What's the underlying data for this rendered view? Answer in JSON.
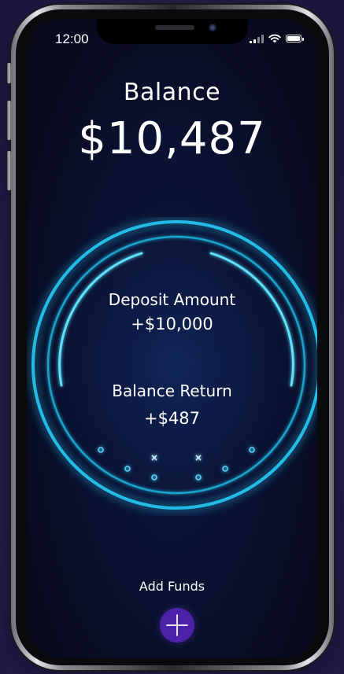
{
  "status_bar": {
    "time": "12:00",
    "icons": [
      "signal-icon",
      "wifi-icon",
      "battery-icon"
    ]
  },
  "balance": {
    "label": "Balance",
    "value": "$10,487"
  },
  "deposit": {
    "label": "Deposit Amount",
    "value": "+$10,000"
  },
  "return": {
    "label": "Balance Return",
    "value": "+$487"
  },
  "actions": {
    "add_funds_label": "Add Funds",
    "add_icon": "plus-icon"
  },
  "colors": {
    "accent_glow": "#25c6f0",
    "add_button": "#4b22a8",
    "background": "#0b1233"
  }
}
